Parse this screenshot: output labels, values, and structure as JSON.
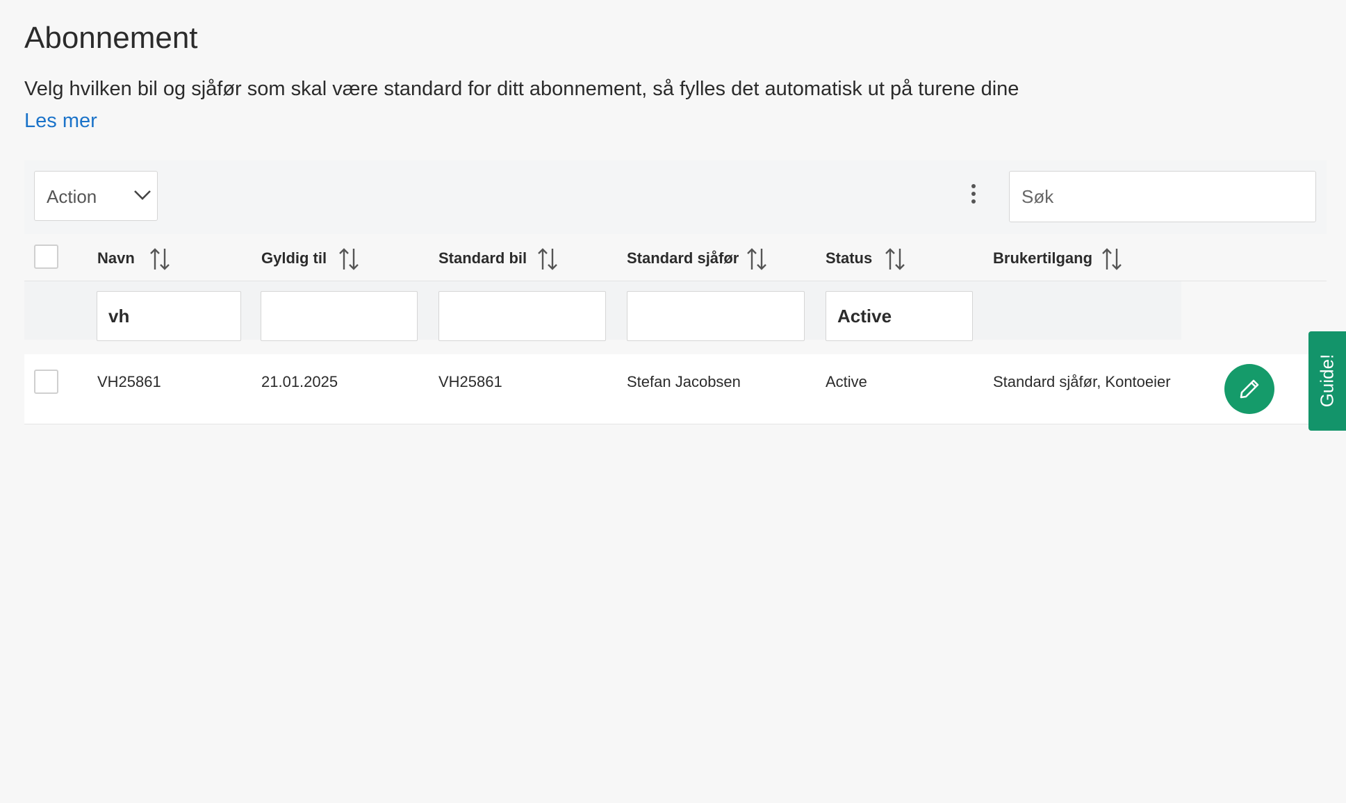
{
  "page": {
    "title": "Abonnement",
    "description": "Velg hvilken bil og sjåfør som skal være standard for ditt abonnement, så fylles det automatisk ut på turene dine",
    "read_more": "Les mer"
  },
  "toolbar": {
    "action_label": "Action",
    "search_placeholder": "Søk",
    "search_value": ""
  },
  "table": {
    "columns": [
      {
        "label": "Navn"
      },
      {
        "label": "Gyldig til"
      },
      {
        "label": "Standard bil"
      },
      {
        "label": "Standard sjåfør"
      },
      {
        "label": "Status"
      },
      {
        "label": "Brukertilgang"
      }
    ],
    "filters": {
      "navn": "vh",
      "gyldig_til": "",
      "standard_bil": "",
      "standard_sjafor": "",
      "status": "Active"
    },
    "rows": [
      {
        "navn": "VH25861",
        "gyldig_til": "21.01.2025",
        "standard_bil": "VH25861",
        "standard_sjafor": "Stefan Jacobsen",
        "status": "Active",
        "brukertilgang": "Standard sjåfør, Kontoeier"
      }
    ]
  },
  "guide": {
    "label": "Guide!"
  },
  "colors": {
    "link": "#1b73c9",
    "accent_green": "#159b6a",
    "guide_green": "#13946a"
  },
  "icons": {
    "action_dropdown": "chevron-down-icon",
    "more": "kebab-menu-icon",
    "sort": "sort-icon",
    "edit": "pencil-icon"
  }
}
